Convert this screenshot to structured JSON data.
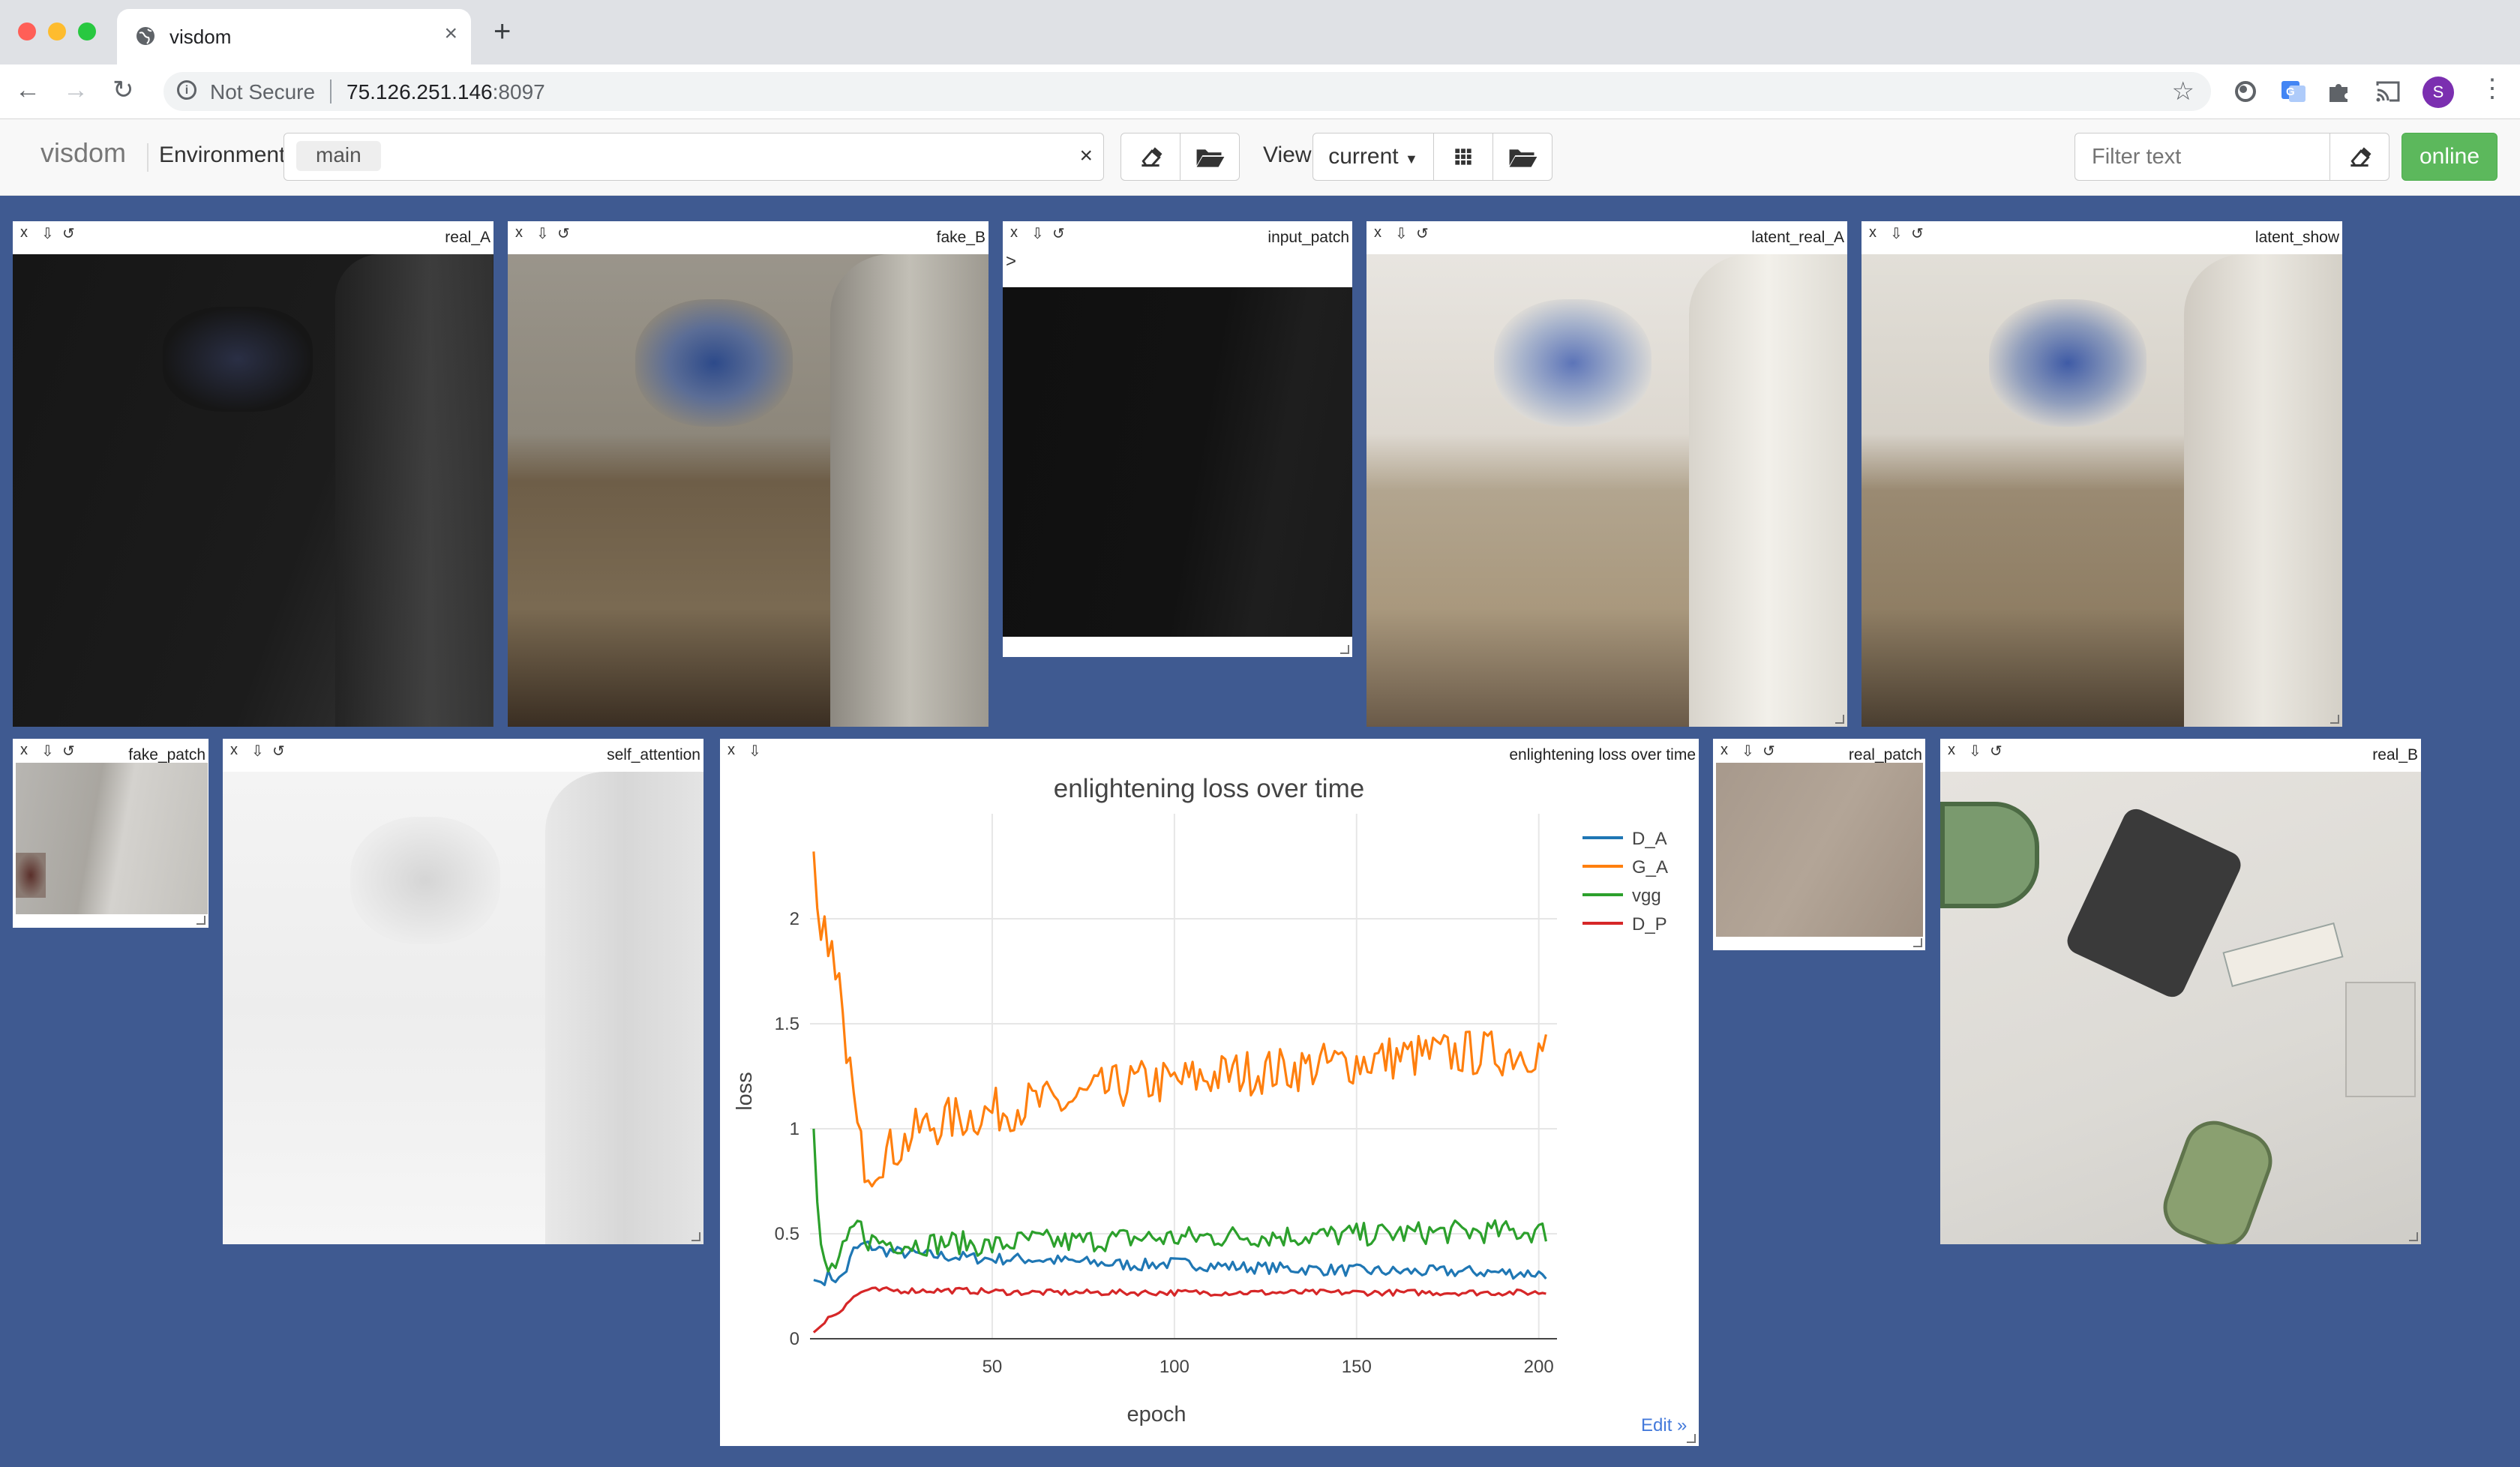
{
  "browser": {
    "tab_title": "visdom",
    "security_label": "Not Secure",
    "url_host": "75.126.251.146",
    "url_port": ":8097",
    "profile_initial": "S"
  },
  "navbar": {
    "brand": "visdom",
    "environment_label": "Environment",
    "environment_tag": "main",
    "view_label": "View",
    "view_value": "current",
    "filter_placeholder": "Filter text",
    "online_label": "online"
  },
  "panes": {
    "real_A": "real_A",
    "fake_B": "fake_B",
    "input_patch": "input_patch",
    "input_patch_caret": ">",
    "latent_real_A": "latent_real_A",
    "latent_show": "latent_show",
    "fake_patch": "fake_patch",
    "self_attention": "self_attention",
    "loss_pane": "enlightening loss over time",
    "real_patch": "real_patch",
    "real_B": "real_B",
    "edit_link": "Edit »"
  },
  "chart_data": {
    "type": "line",
    "title": "enlightening loss over time",
    "xlabel": "epoch",
    "ylabel": "loss",
    "xlim": [
      0,
      205
    ],
    "ylim": [
      0,
      2.5
    ],
    "xticks": [
      50,
      100,
      150,
      200
    ],
    "yticks": [
      0,
      0.5,
      1,
      1.5,
      2
    ],
    "grid": true,
    "legend_position": "top-right",
    "series": [
      {
        "name": "D_A",
        "color": "#1f77b4",
        "keypoints": [
          [
            1,
            0.28
          ],
          [
            3,
            0.27
          ],
          [
            5,
            0.3
          ],
          [
            8,
            0.28
          ],
          [
            10,
            0.33
          ],
          [
            12,
            0.42
          ],
          [
            15,
            0.45
          ],
          [
            20,
            0.42
          ],
          [
            30,
            0.4
          ],
          [
            40,
            0.39
          ],
          [
            50,
            0.38
          ],
          [
            60,
            0.38
          ],
          [
            70,
            0.37
          ],
          [
            80,
            0.36
          ],
          [
            90,
            0.35
          ],
          [
            100,
            0.36
          ],
          [
            120,
            0.34
          ],
          [
            140,
            0.33
          ],
          [
            160,
            0.32
          ],
          [
            180,
            0.32
          ],
          [
            202,
            0.31
          ]
        ],
        "noise": 0.018
      },
      {
        "name": "G_A",
        "color": "#ff7f0e",
        "keypoints": [
          [
            1,
            2.32
          ],
          [
            2,
            2.05
          ],
          [
            3,
            1.9
          ],
          [
            4,
            1.95
          ],
          [
            5,
            1.75
          ],
          [
            6,
            1.8
          ],
          [
            7,
            1.62
          ],
          [
            8,
            1.7
          ],
          [
            9,
            1.45
          ],
          [
            10,
            1.42
          ],
          [
            11,
            1.28
          ],
          [
            12,
            1.15
          ],
          [
            13,
            0.98
          ],
          [
            14,
            0.9
          ],
          [
            15,
            0.85
          ],
          [
            17,
            0.82
          ],
          [
            20,
            0.88
          ],
          [
            25,
            0.92
          ],
          [
            30,
            1.0
          ],
          [
            40,
            1.05
          ],
          [
            50,
            1.08
          ],
          [
            60,
            1.12
          ],
          [
            70,
            1.12
          ],
          [
            80,
            1.18
          ],
          [
            90,
            1.22
          ],
          [
            100,
            1.22
          ],
          [
            110,
            1.25
          ],
          [
            120,
            1.27
          ],
          [
            130,
            1.28
          ],
          [
            140,
            1.3
          ],
          [
            150,
            1.32
          ],
          [
            160,
            1.34
          ],
          [
            170,
            1.35
          ],
          [
            180,
            1.36
          ],
          [
            190,
            1.36
          ],
          [
            202,
            1.38
          ]
        ],
        "noise": 0.07
      },
      {
        "name": "vgg",
        "color": "#2ca02c",
        "keypoints": [
          [
            1,
            1.0
          ],
          [
            2,
            0.65
          ],
          [
            3,
            0.45
          ],
          [
            4,
            0.35
          ],
          [
            5,
            0.32
          ],
          [
            7,
            0.35
          ],
          [
            10,
            0.44
          ],
          [
            13,
            0.55
          ],
          [
            16,
            0.47
          ],
          [
            20,
            0.46
          ],
          [
            30,
            0.45
          ],
          [
            40,
            0.46
          ],
          [
            50,
            0.44
          ],
          [
            60,
            0.47
          ],
          [
            70,
            0.46
          ],
          [
            80,
            0.47
          ],
          [
            90,
            0.48
          ],
          [
            100,
            0.48
          ],
          [
            120,
            0.49
          ],
          [
            140,
            0.49
          ],
          [
            160,
            0.5
          ],
          [
            180,
            0.51
          ],
          [
            202,
            0.51
          ]
        ],
        "noise": 0.035
      },
      {
        "name": "D_P",
        "color": "#d62728",
        "keypoints": [
          [
            1,
            0.03
          ],
          [
            3,
            0.06
          ],
          [
            5,
            0.1
          ],
          [
            8,
            0.13
          ],
          [
            10,
            0.17
          ],
          [
            13,
            0.21
          ],
          [
            15,
            0.23
          ],
          [
            20,
            0.23
          ],
          [
            40,
            0.23
          ],
          [
            60,
            0.22
          ],
          [
            80,
            0.22
          ],
          [
            100,
            0.22
          ],
          [
            130,
            0.22
          ],
          [
            160,
            0.22
          ],
          [
            202,
            0.22
          ]
        ],
        "noise": 0.009
      }
    ]
  }
}
